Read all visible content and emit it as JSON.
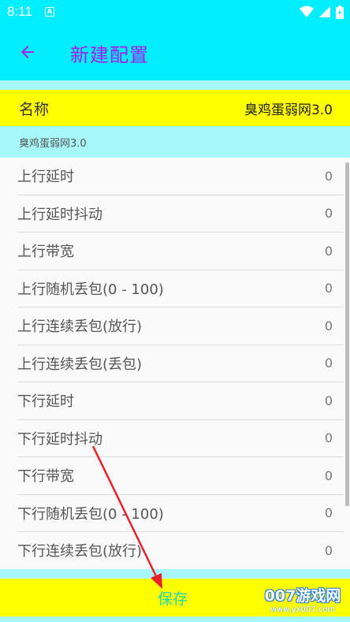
{
  "status_bar": {
    "time": "8:11",
    "notification_icon": "a-icon",
    "icons": [
      "wifi-icon",
      "signal-icon",
      "battery-icon"
    ]
  },
  "app_bar": {
    "back_icon": "arrow-left-icon",
    "title": "新建配置"
  },
  "name_row": {
    "label": "名称",
    "value": "臭鸡蛋弱网3.0"
  },
  "subtitle": "臭鸡蛋弱网3.0",
  "settings": [
    {
      "label": "上行延时",
      "value": "0"
    },
    {
      "label": "上行延时抖动",
      "value": "0"
    },
    {
      "label": "上行带宽",
      "value": "0"
    },
    {
      "label": "上行随机丢包(0 - 100)",
      "value": "0"
    },
    {
      "label": "上行连续丢包(放行)",
      "value": "0"
    },
    {
      "label": "上行连续丢包(丢包)",
      "value": "0"
    },
    {
      "label": "下行延时",
      "value": "0"
    },
    {
      "label": "下行延时抖动",
      "value": "0"
    },
    {
      "label": "下行带宽",
      "value": "0"
    },
    {
      "label": "下行随机丢包(0 - 100)",
      "value": "0"
    },
    {
      "label": "下行连续丢包(放行)",
      "value": "0"
    }
  ],
  "save_label": "保存",
  "watermark": {
    "main": "007游戏网",
    "sub": "www.yx007.com"
  },
  "colors": {
    "primary": "#00eeff",
    "accent": "#a31ff0",
    "highlight": "#ffff00",
    "light_cyan": "#a8f7fb",
    "save_text": "#20d9b0",
    "annotation": "#e8202a"
  }
}
